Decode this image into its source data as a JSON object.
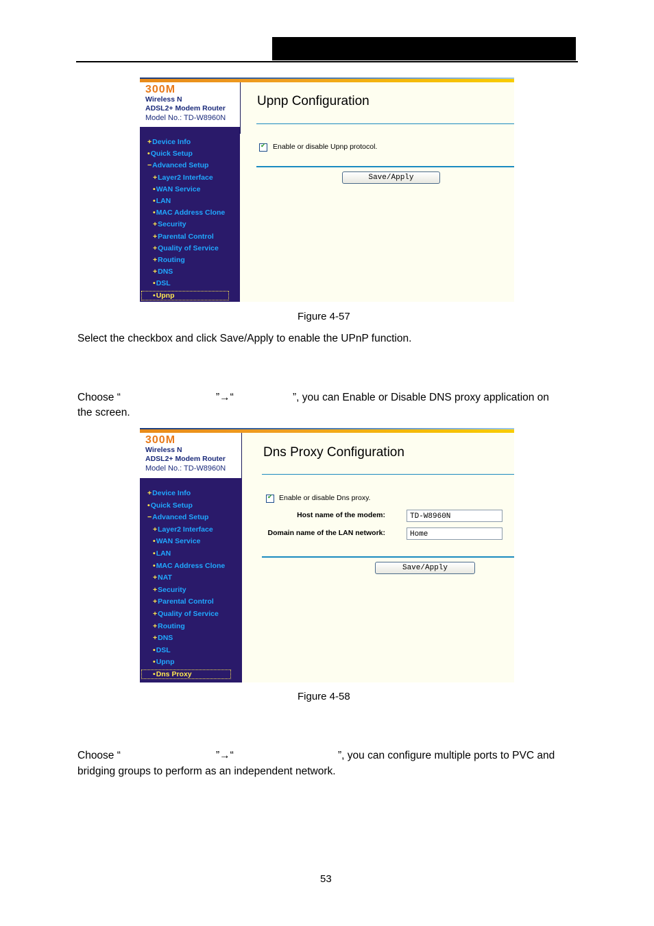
{
  "page": {
    "page_number": "53"
  },
  "figures": [
    {
      "caption": "Figure 4-57",
      "logo": {
        "line1": "300M",
        "line2": "Wireless N",
        "line3": "ADSL2+ Modem Router",
        "line4": "Model No.: TD-W8960N"
      },
      "nav": [
        {
          "marker": "+",
          "label": "Device Info"
        },
        {
          "marker": "•",
          "label": "Quick Setup"
        },
        {
          "marker": "−",
          "label": "Advanced Setup"
        },
        {
          "marker": "+",
          "label": "Layer2 Interface"
        },
        {
          "marker": "•",
          "label": "WAN Service"
        },
        {
          "marker": "•",
          "label": "LAN"
        },
        {
          "marker": "•",
          "label": "MAC Address Clone"
        },
        {
          "marker": "+",
          "label": "Security"
        },
        {
          "marker": "+",
          "label": "Parental Control"
        },
        {
          "marker": "+",
          "label": "Quality of Service"
        },
        {
          "marker": "+",
          "label": "Routing"
        },
        {
          "marker": "+",
          "label": "DNS"
        },
        {
          "marker": "•",
          "label": "DSL"
        },
        {
          "marker": "•",
          "label": "Upnp",
          "selected": true
        }
      ],
      "title": "Upnp Configuration",
      "checkbox_label": "Enable or disable Upnp protocol.",
      "checkbox_checked": true,
      "button": "Save/Apply"
    },
    {
      "caption": "Figure 4-58",
      "logo": {
        "line1": "300M",
        "line2": "Wireless N",
        "line3": "ADSL2+ Modem Router",
        "line4": "Model No.: TD-W8960N"
      },
      "nav": [
        {
          "marker": "+",
          "label": "Device Info"
        },
        {
          "marker": "•",
          "label": "Quick Setup"
        },
        {
          "marker": "−",
          "label": "Advanced Setup"
        },
        {
          "marker": "+",
          "label": "Layer2 Interface"
        },
        {
          "marker": "•",
          "label": "WAN Service"
        },
        {
          "marker": "•",
          "label": "LAN"
        },
        {
          "marker": "•",
          "label": "MAC Address Clone"
        },
        {
          "marker": "+",
          "label": "NAT"
        },
        {
          "marker": "+",
          "label": "Security"
        },
        {
          "marker": "+",
          "label": "Parental Control"
        },
        {
          "marker": "+",
          "label": "Quality of Service"
        },
        {
          "marker": "+",
          "label": "Routing"
        },
        {
          "marker": "+",
          "label": "DNS"
        },
        {
          "marker": "•",
          "label": "DSL"
        },
        {
          "marker": "•",
          "label": "Upnp"
        },
        {
          "marker": "•",
          "label": "Dns Proxy",
          "selected": true
        }
      ],
      "title": "Dns Proxy Configuration",
      "checkbox_label": "Enable or disable Dns proxy.",
      "checkbox_checked": true,
      "host_label": "Host name of the modem:",
      "host_value": "TD-W8960N",
      "domain_label": "Domain name of the LAN network:",
      "domain_value": "Home",
      "button": "Save/Apply"
    }
  ],
  "text": {
    "p1": "Select the checkbox and click Save/Apply to enable the UPnP function.",
    "p2_a": "Choose “",
    "p2_b": "”→“",
    "p2_c": "”, you can Enable or Disable DNS proxy application on",
    "p2_d": "the screen.",
    "p3_a": "Choose “",
    "p3_b": "”→“",
    "p3_c": "”, you can configure multiple ports to PVC and",
    "p3_d": "bridging groups to perform as an independent network."
  }
}
